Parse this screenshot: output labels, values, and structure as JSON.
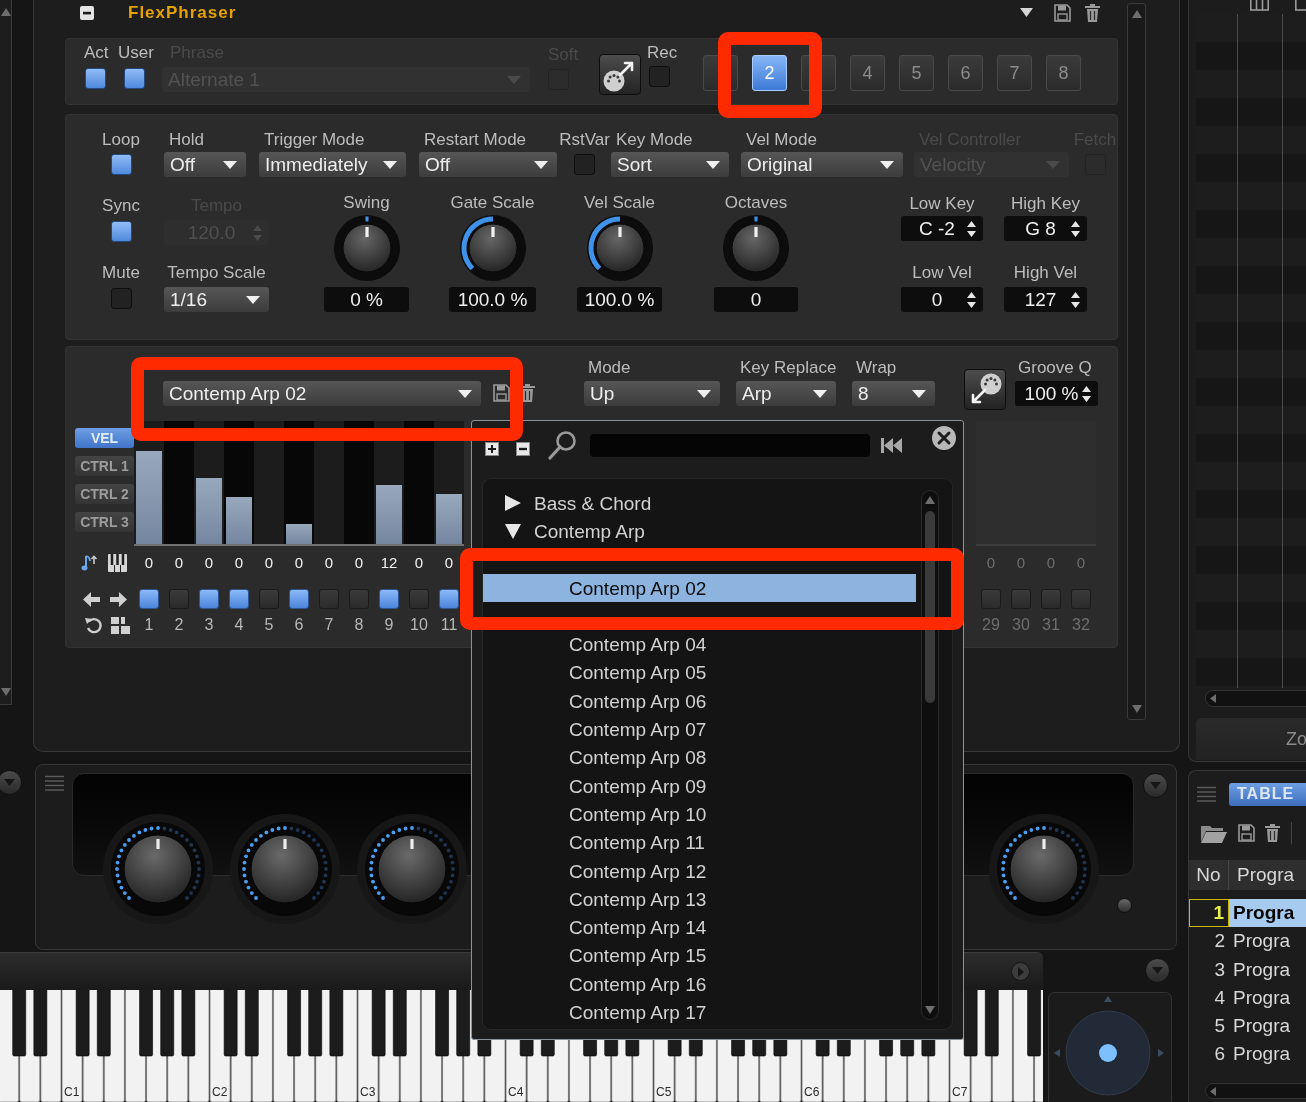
{
  "panel": {
    "title": "FlexPhraser"
  },
  "phrase_row": {
    "act": {
      "label": "Act",
      "checked": true
    },
    "user": {
      "label": "User",
      "checked": true
    },
    "phrase": {
      "label": "Phrase",
      "value": "Alternate 1",
      "disabled": true
    },
    "soft": {
      "label": "Soft",
      "checked": false,
      "disabled": true
    },
    "rec": {
      "label": "Rec",
      "checked": false
    },
    "slots": [
      {
        "selected": false,
        "highlighted": false
      },
      {
        "label": "2",
        "selected": true,
        "highlighted": true
      },
      {
        "selected": false,
        "highlighted": false
      },
      {
        "label": "4",
        "selected": false,
        "highlighted": false
      },
      {
        "label": "5",
        "selected": false,
        "highlighted": false
      },
      {
        "label": "6",
        "selected": false,
        "highlighted": false
      },
      {
        "label": "7",
        "selected": false,
        "highlighted": false
      },
      {
        "label": "8",
        "selected": false,
        "highlighted": false
      }
    ]
  },
  "settings": {
    "row1": [
      {
        "kind": "checkbox",
        "label": "Loop",
        "checked": true,
        "disabled": false
      },
      {
        "kind": "dropdown",
        "label": "Hold",
        "value": "Off",
        "disabled": false
      },
      {
        "kind": "dropdown",
        "label": "Trigger Mode",
        "value": "Immediately",
        "disabled": false
      },
      {
        "kind": "dropdown",
        "label": "Restart Mode",
        "value": "Off",
        "disabled": false
      },
      {
        "kind": "checkbox",
        "label": "RstVar",
        "checked": false,
        "disabled": false
      },
      {
        "kind": "dropdown",
        "label": "Key Mode",
        "value": "Sort",
        "disabled": false
      },
      {
        "kind": "dropdown",
        "label": "Vel Mode",
        "value": "Original",
        "disabled": false
      },
      {
        "kind": "dropdown",
        "label": "Vel Controller",
        "value": "Velocity",
        "disabled": true
      },
      {
        "kind": "checkbox",
        "label": "Fetch",
        "checked": false,
        "disabled": true
      }
    ],
    "sync_mute": [
      {
        "label": "Sync",
        "checked": true
      },
      {
        "label": "Mute",
        "checked": false
      }
    ],
    "tempo": {
      "label": "Tempo",
      "value": "120.0",
      "disabled": true
    },
    "tempo_scale": {
      "label": "Tempo Scale",
      "value": "1/16"
    },
    "knobs": [
      {
        "label": "Swing",
        "value": "0 %",
        "level": 0.5,
        "kind": "bipolar"
      },
      {
        "label": "Gate Scale",
        "value": "100.0 %",
        "level": 0.5,
        "kind": "unipolar"
      },
      {
        "label": "Vel Scale",
        "value": "100.0 %",
        "level": 0.5,
        "kind": "unipolar"
      },
      {
        "label": "Octaves",
        "value": "0",
        "level": 0.5,
        "kind": "bipolar"
      }
    ],
    "ranges": [
      {
        "label": "Low Key",
        "value": "C -2"
      },
      {
        "label": "High Key",
        "value": "G 8"
      },
      {
        "label": "Low Vel",
        "value": "0"
      },
      {
        "label": "High Vel",
        "value": "127"
      }
    ]
  },
  "pattern": {
    "selector": {
      "value": "Contemp Arp 02",
      "highlighted": true
    },
    "options": [
      {
        "label": "Mode",
        "value": "Up"
      },
      {
        "label": "Key Replace",
        "value": "Arp"
      },
      {
        "label": "Wrap",
        "value": "8"
      }
    ],
    "groove_q": {
      "label": "Groove Q",
      "value": "100 %"
    },
    "lanes": [
      {
        "label": "VEL",
        "selected": true
      },
      {
        "label": "CTRL 1",
        "selected": false
      },
      {
        "label": "CTRL 2",
        "selected": false
      },
      {
        "label": "CTRL 3",
        "selected": false
      }
    ],
    "step_groups": [
      [
        {
          "number": "1",
          "value": "0",
          "on": true,
          "level": 0.79,
          "disabled": false
        },
        {
          "number": "2",
          "value": "0",
          "on": false,
          "disabled": false
        },
        {
          "number": "3",
          "value": "0",
          "on": true,
          "level": 0.56,
          "disabled": false
        },
        {
          "number": "4",
          "value": "0",
          "on": true,
          "level": 0.4,
          "disabled": false
        },
        {
          "number": "5",
          "value": "0",
          "on": false,
          "disabled": false
        },
        {
          "number": "6",
          "value": "0",
          "on": true,
          "level": 0.17,
          "disabled": false
        },
        {
          "number": "7",
          "value": "0",
          "on": false,
          "disabled": false
        },
        {
          "number": "8",
          "value": "0",
          "on": false,
          "disabled": false
        },
        {
          "number": "9",
          "value": "12",
          "on": true,
          "level": 0.5,
          "disabled": false
        },
        {
          "number": "10",
          "value": "0",
          "on": false,
          "disabled": false
        },
        {
          "number": "11",
          "value": "0",
          "on": true,
          "level": 0.42,
          "disabled": false
        }
      ],
      [
        {
          "number": "29",
          "value": "0",
          "on": false,
          "disabled": true
        },
        {
          "number": "30",
          "value": "0",
          "on": false,
          "disabled": true
        },
        {
          "number": "31",
          "value": "0",
          "on": false,
          "disabled": true
        },
        {
          "number": "32",
          "value": "0",
          "on": false,
          "disabled": true
        }
      ]
    ]
  },
  "pattern_browser": {
    "tree": [
      {
        "label": "Bass & Chord",
        "expanded": false,
        "selected": false,
        "highlighted": false
      },
      {
        "label": "Contemp Arp",
        "expanded": true,
        "selected": false,
        "highlighted": false,
        "children": [
          {
            "selected": false,
            "highlighted": false
          },
          {
            "label": "Contemp Arp 02",
            "selected": true,
            "highlighted": true
          },
          {
            "selected": false,
            "highlighted": false
          },
          {
            "label": "Contemp Arp 04",
            "selected": false,
            "highlighted": false
          },
          {
            "label": "Contemp Arp 05",
            "selected": false,
            "highlighted": false
          },
          {
            "label": "Contemp Arp 06",
            "selected": false,
            "highlighted": false
          },
          {
            "label": "Contemp Arp 07",
            "selected": false,
            "highlighted": false
          },
          {
            "label": "Contemp Arp 08",
            "selected": false,
            "highlighted": false
          },
          {
            "label": "Contemp Arp 09",
            "selected": false,
            "highlighted": false
          },
          {
            "label": "Contemp Arp 10",
            "selected": false,
            "highlighted": false
          },
          {
            "label": "Contemp Arp 11",
            "selected": false,
            "highlighted": false
          },
          {
            "label": "Contemp Arp 12",
            "selected": false,
            "highlighted": false
          },
          {
            "label": "Contemp Arp 13",
            "selected": false,
            "highlighted": false
          },
          {
            "label": "Contemp Arp 14",
            "selected": false,
            "highlighted": false
          },
          {
            "label": "Contemp Arp 15",
            "selected": false,
            "highlighted": false
          },
          {
            "label": "Contemp Arp 16",
            "selected": false,
            "highlighted": false
          },
          {
            "label": "Contemp Arp 17",
            "selected": false,
            "highlighted": false
          }
        ]
      }
    ]
  },
  "quick_controls": [
    {
      "level": 0.5
    },
    {
      "level": 0.5
    },
    {
      "level": 0.5
    },
    {
      "level": 0.5
    }
  ],
  "keyboard": {
    "octave_labels": [
      "C1",
      "C2",
      "C3",
      "C4",
      "C5",
      "C6",
      "C7"
    ]
  },
  "side_panel": {
    "zoom_button": "Zo",
    "tab": {
      "label": "TABLE",
      "selected": true
    },
    "table": {
      "columns": [
        "No",
        "Progra"
      ],
      "rows": [
        {
          "number": "1",
          "program": "Progra",
          "selected": true
        },
        {
          "number": "2",
          "program": "Progra",
          "selected": false
        },
        {
          "number": "3",
          "program": "Progra",
          "selected": false
        },
        {
          "number": "4",
          "program": "Progra",
          "selected": false
        },
        {
          "number": "5",
          "program": "Progra",
          "selected": false
        },
        {
          "number": "6",
          "program": "Progra",
          "selected": false
        }
      ]
    }
  }
}
